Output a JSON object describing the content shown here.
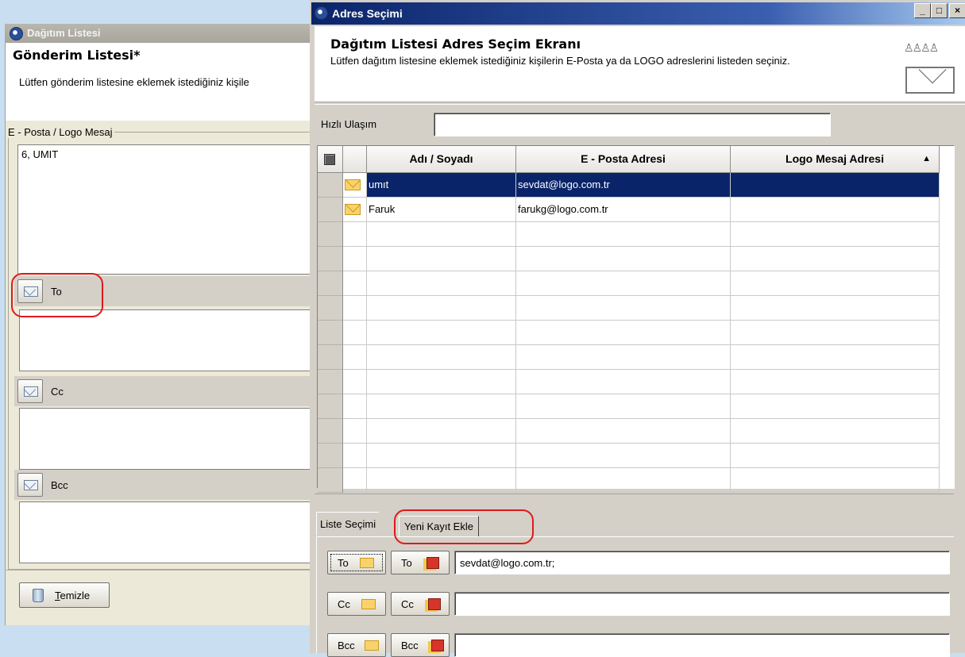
{
  "back_window": {
    "title": "Dağıtım Listesi",
    "header_title": "Gönderim Listesi*",
    "header_subtitle": "Lütfen gönderim listesine eklemek istediğiniz kişile",
    "group_label": "E - Posta / Logo Mesaj",
    "message_value": "6, UMIT",
    "to_label": "To",
    "cc_label": "Cc",
    "bcc_label": "Bcc",
    "clear_button_first": "T",
    "clear_button_rest": "emizle"
  },
  "dialog": {
    "title": "Adres Seçimi",
    "caption_buttons": {
      "minimize": "_",
      "maximize": "□",
      "close": "×"
    },
    "header_title": "Dağıtım Listesi Adres Seçim Ekranı",
    "header_subtitle": "Lütfen dağıtım listesine eklemek istediğiniz kişilerin E-Posta ya da LOGO adreslerini listeden seçiniz.",
    "quick_access_label": "Hızlı Ulaşım",
    "quick_access_value": "",
    "grid": {
      "columns": [
        "Adı / Soyadı",
        "E - Posta Adresi",
        "Logo Mesaj Adresi"
      ],
      "sort_indicator": "▲",
      "rows": [
        {
          "name": "umıt",
          "email": "sevdat@logo.com.tr",
          "logo": "",
          "selected": true
        },
        {
          "name": "Faruk",
          "email": "farukg@logo.com.tr",
          "logo": "",
          "selected": false
        }
      ],
      "empty_rows": 11
    },
    "tabs": [
      "Liste Seçimi",
      "Yeni Kayıt Ekle"
    ],
    "selection": {
      "to_email_btn": "To",
      "to_logo_btn": "To",
      "to_value": "sevdat@logo.com.tr;",
      "cc_email_btn": "Cc",
      "cc_logo_btn": "Cc",
      "cc_value": "",
      "bcc_email_btn": "Bcc",
      "bcc_logo_btn": "Bcc",
      "bcc_value": ""
    }
  },
  "colors": {
    "selection": "#0a246a",
    "annotation": "#e0191b",
    "desktop": "#c9def0"
  }
}
